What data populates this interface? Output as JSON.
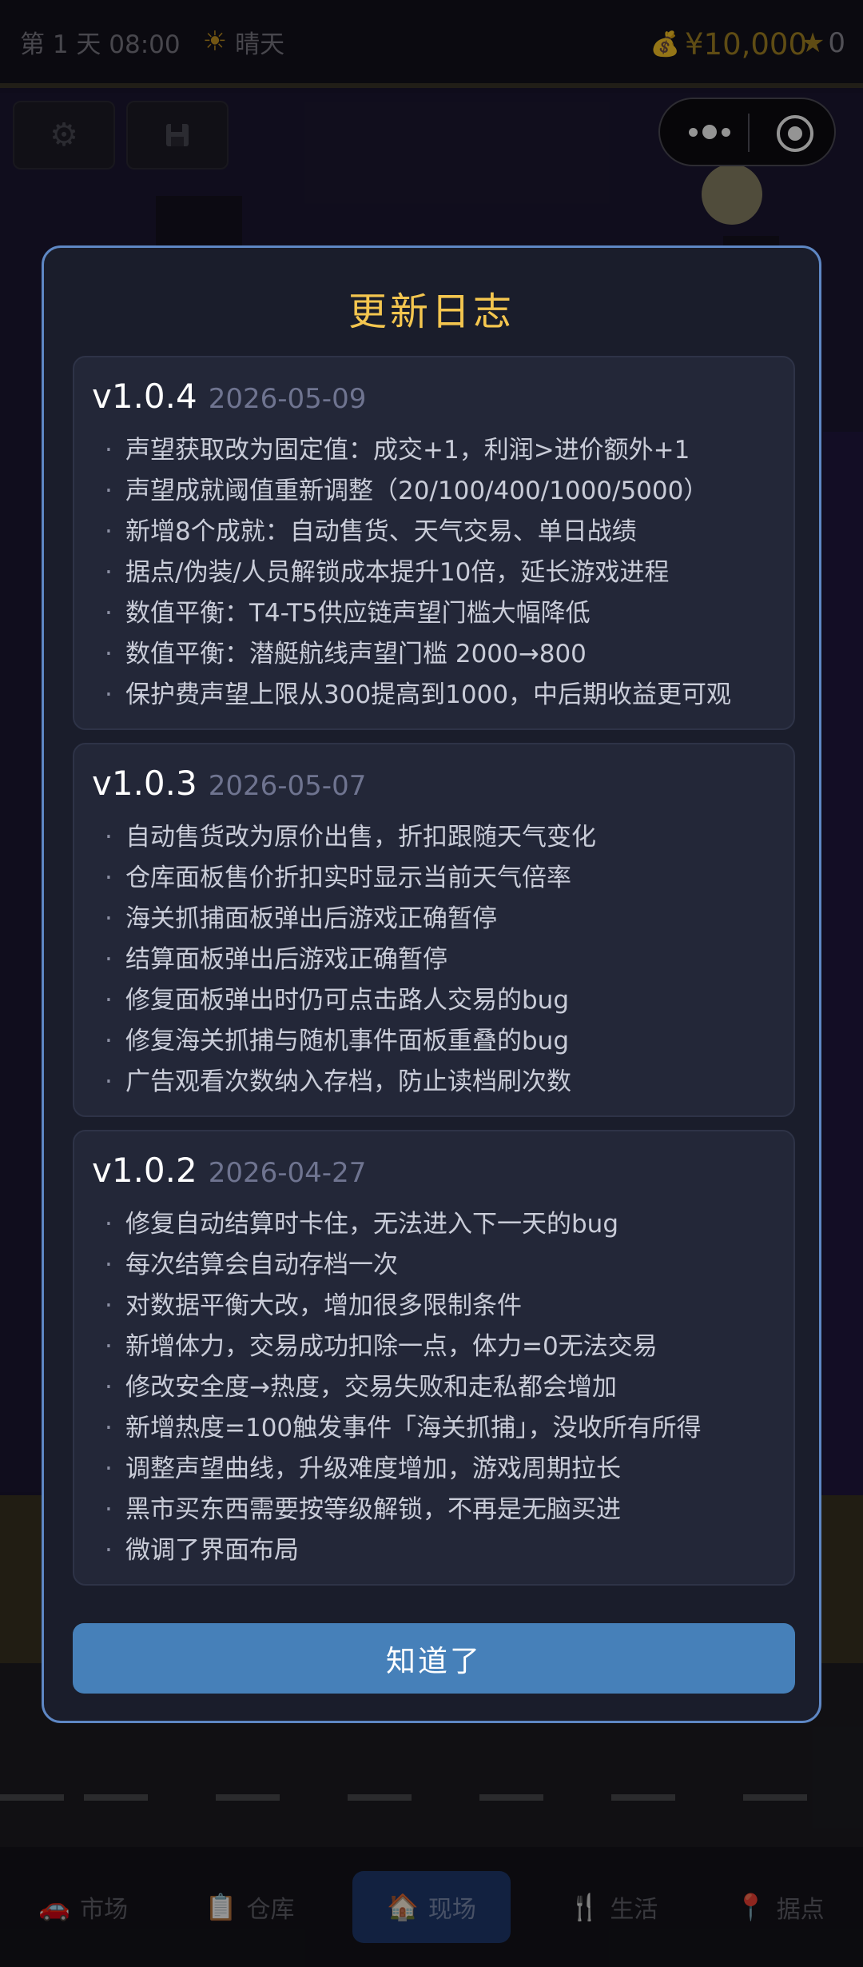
{
  "status_bar": {
    "day_time": "第 1 天 08:00",
    "weather_icon": "sun-icon",
    "weather": "晴天",
    "money_icon": "money-bag-icon",
    "money": "¥10,000",
    "star_icon": "star-icon",
    "reputation": "0"
  },
  "toolbar": {
    "settings_icon": "gear-icon",
    "save_icon": "floppy-disk-icon"
  },
  "capsule": {
    "more_icon": "more-dots-icon",
    "close_icon": "target-circle-icon"
  },
  "changelog": {
    "title": "更新日志",
    "entries": [
      {
        "version": "v1.0.4",
        "date": "2026-05-09",
        "items": [
          "声望获取改为固定值：成交+1，利润>进价额外+1",
          "声望成就阈值重新调整（20/100/400/1000/5000）",
          "新增8个成就：自动售货、天气交易、单日战绩",
          "据点/伪装/人员解锁成本提升10倍，延长游戏进程",
          "数值平衡：T4-T5供应链声望门槛大幅降低",
          "数值平衡：潜艇航线声望门槛 2000→800",
          "保护费声望上限从300提高到1000，中后期收益更可观"
        ]
      },
      {
        "version": "v1.0.3",
        "date": "2026-05-07",
        "items": [
          "自动售货改为原价出售，折扣跟随天气变化",
          "仓库面板售价折扣实时显示当前天气倍率",
          "海关抓捕面板弹出后游戏正确暂停",
          "结算面板弹出后游戏正确暂停",
          "修复面板弹出时仍可点击路人交易的bug",
          "修复海关抓捕与随机事件面板重叠的bug",
          "广告观看次数纳入存档，防止读档刷次数"
        ]
      },
      {
        "version": "v1.0.2",
        "date": "2026-04-27",
        "items": [
          "修复自动结算时卡住，无法进入下一天的bug",
          "每次结算会自动存档一次",
          "对数据平衡大改，增加很多限制条件",
          "新增体力，交易成功扣除一点，体力=0无法交易",
          "修改安全度→热度，交易失败和走私都会增加",
          "新增热度=100触发事件「海关抓捕」，没收所有所得",
          "调整声望曲线，升级难度增加，游戏周期拉长",
          "黑市买东西需要按等级解锁，不再是无脑买进",
          "微调了界面布局"
        ]
      }
    ],
    "confirm_label": "知道了"
  },
  "bottom_nav": [
    {
      "label": "市场",
      "icon": "car-icon",
      "active": false
    },
    {
      "label": "仓库",
      "icon": "clipboard-icon",
      "active": false
    },
    {
      "label": "现场",
      "icon": "house-icon",
      "active": true
    },
    {
      "label": "生活",
      "icon": "fork-knife-icon",
      "active": false
    },
    {
      "label": "据点",
      "icon": "map-pin-icon",
      "active": false
    }
  ]
}
